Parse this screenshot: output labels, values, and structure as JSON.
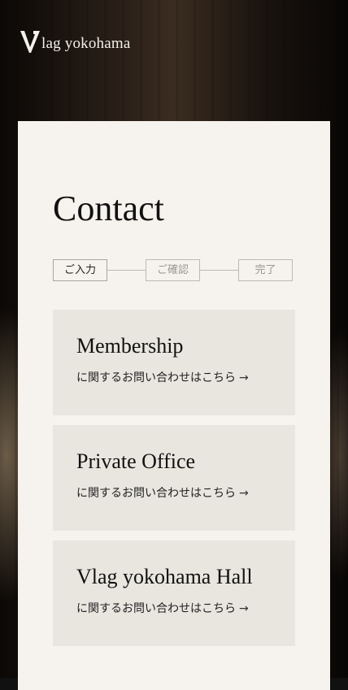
{
  "header": {
    "logo_text": "lag yokohama",
    "logo_mark": "V"
  },
  "main": {
    "title": "Contact",
    "steps": [
      {
        "label": "ご入力",
        "active": true
      },
      {
        "label": "ご確認",
        "active": false
      },
      {
        "label": "完了",
        "active": false
      }
    ],
    "cards": [
      {
        "title": "Membership",
        "subtitle": "に関するお問い合わせはこちら",
        "icon": "arrow-right-icon",
        "arrow": "→"
      },
      {
        "title": "Private Office",
        "subtitle": "に関するお問い合わせはこちら",
        "icon": "arrow-right-icon",
        "arrow": "→"
      },
      {
        "title": "Vlag yokohama Hall",
        "subtitle": "に関するお問い合わせはこちら",
        "icon": "arrow-right-icon",
        "arrow": "→"
      }
    ]
  },
  "colors": {
    "panel_background": "#f6f3ee",
    "card_background": "#e9e6e0",
    "text": "#111111",
    "step_border": "#bdbab4"
  }
}
